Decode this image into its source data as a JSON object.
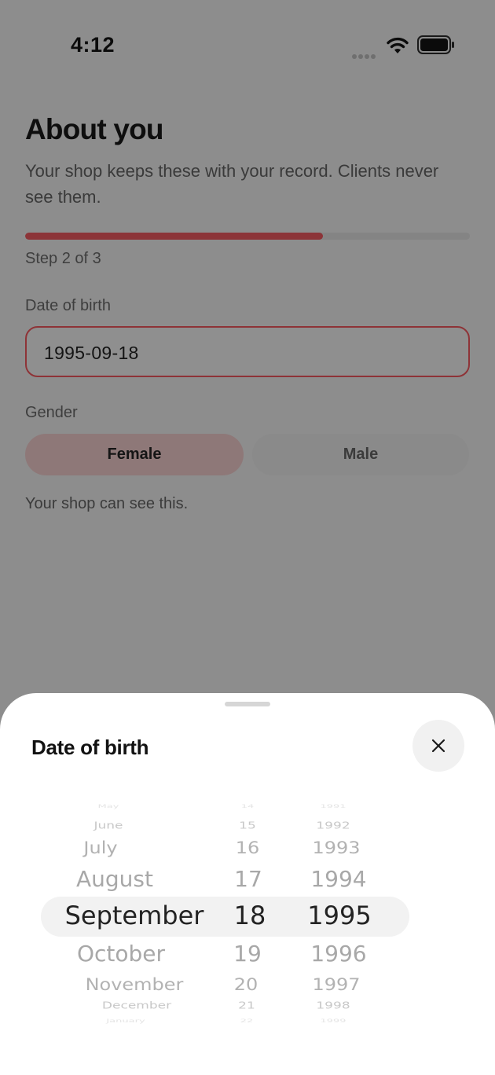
{
  "status_bar": {
    "time": "4:12",
    "icons": [
      "cellular-signal-icon",
      "wifi-icon",
      "battery-icon"
    ]
  },
  "page": {
    "title": "About you",
    "subtitle": "Your shop keeps these with your record. Clients never see them.",
    "progress": {
      "fraction": 0.67,
      "label": "Step 2 of 3"
    },
    "dob": {
      "label": "Date of birth",
      "value": "1995-09-18"
    },
    "gender": {
      "label": "Gender",
      "options": [
        "Female",
        "Male"
      ],
      "selected": "Female",
      "hint": "Your shop can see this."
    }
  },
  "sheet": {
    "title": "Date of birth",
    "close_icon": "close-icon",
    "picker": {
      "months": [
        "May",
        "June",
        "July",
        "August",
        "September",
        "October",
        "November",
        "December",
        "January"
      ],
      "days": [
        "14",
        "15",
        "16",
        "17",
        "18",
        "19",
        "20",
        "21",
        "22"
      ],
      "years": [
        "1991",
        "1992",
        "1993",
        "1994",
        "1995",
        "1996",
        "1997",
        "1998",
        "1999"
      ],
      "selected": {
        "month": "September",
        "day": "18",
        "year": "1995"
      }
    }
  },
  "colors": {
    "accent": "#c0393f",
    "scrim": "#8d8d8d",
    "sheet_background": "#ffffff"
  }
}
